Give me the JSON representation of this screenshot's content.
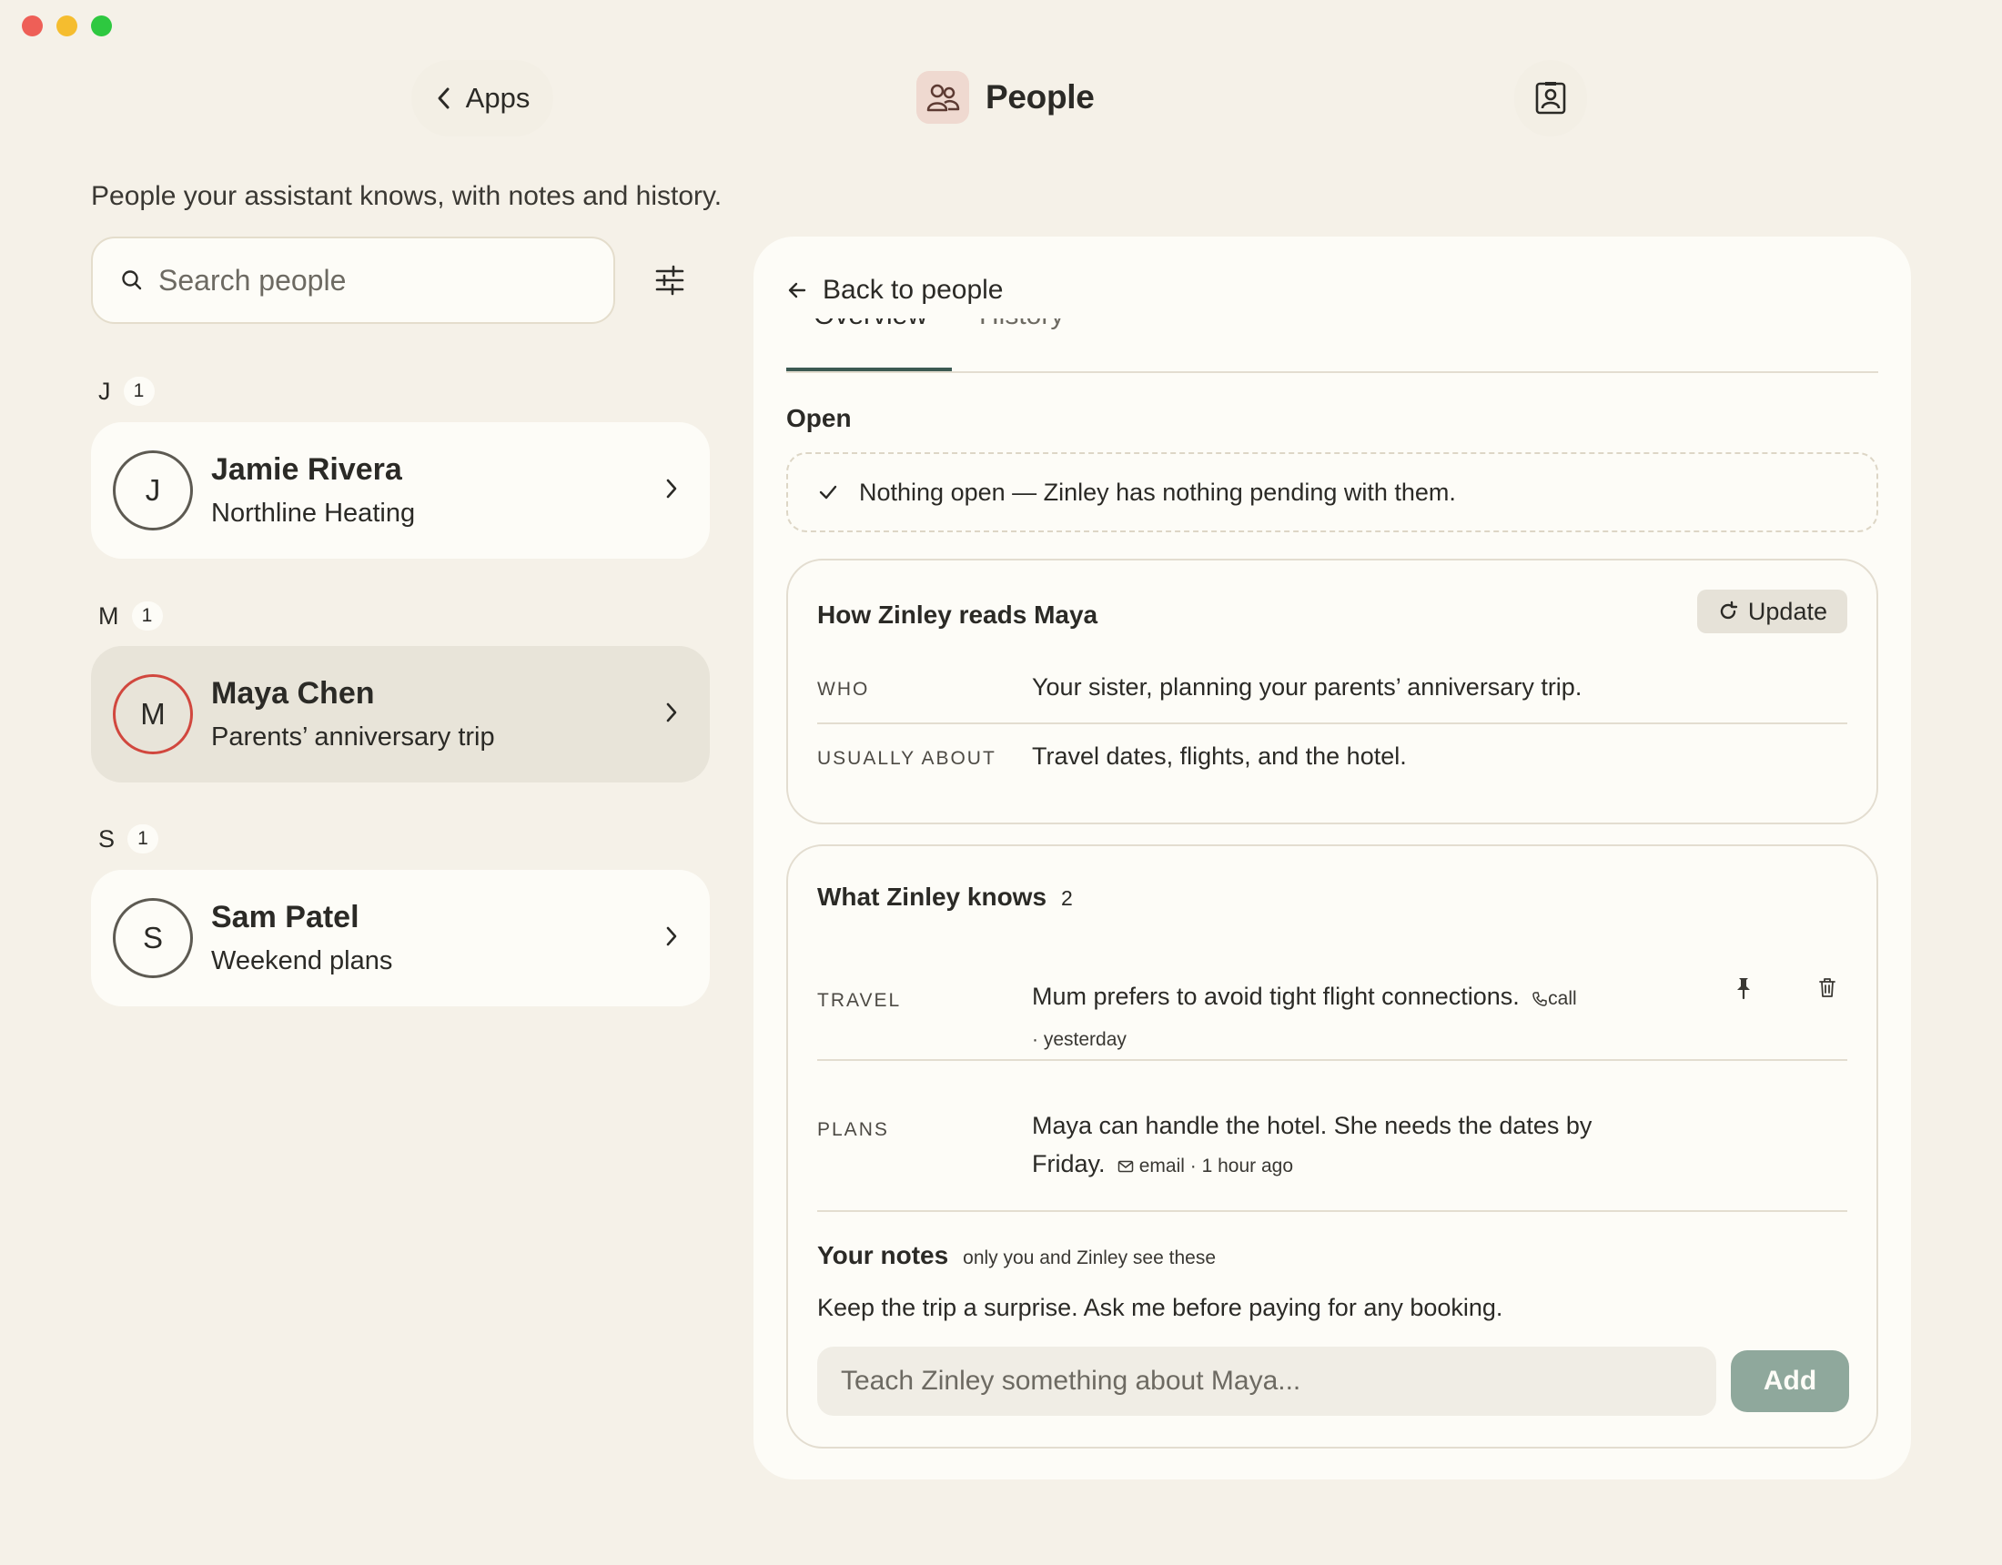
{
  "window": {
    "title": "People"
  },
  "header": {
    "back_label": "Apps",
    "title": "People",
    "back_icon": "chevron-left-icon",
    "app_icon": "people-icon",
    "contact_icon": "contact-card-icon"
  },
  "subtitle": "People your assistant knows, with notes and history.",
  "search": {
    "placeholder": "Search people",
    "value": ""
  },
  "groups": [
    {
      "letter": "J",
      "count": "1",
      "people": [
        {
          "initial": "J",
          "name": "Jamie Rivera",
          "subtitle": "Northline Heating"
        }
      ]
    },
    {
      "letter": "M",
      "count": "1",
      "people": [
        {
          "initial": "M",
          "name": "Maya Chen",
          "subtitle": "Parents’ anniversary trip",
          "selected": true
        }
      ]
    },
    {
      "letter": "S",
      "count": "1",
      "people": [
        {
          "initial": "S",
          "name": "Sam Patel",
          "subtitle": "Weekend plans"
        }
      ]
    }
  ],
  "detail": {
    "back_label": "Back to people",
    "tabs": [
      {
        "label": "Overview",
        "active": true
      },
      {
        "label": "History",
        "active": false
      }
    ],
    "open_label": "Open",
    "open_message": "Nothing open — Zinley has nothing pending with them.",
    "reads": {
      "title": "How Zinley reads Maya",
      "update_label": "Update",
      "rows": [
        {
          "label": "WHO",
          "value": "Your sister, planning your parents’ anniversary trip."
        },
        {
          "label": "USUALLY ABOUT",
          "value": "Travel dates, flights, and the hotel."
        }
      ]
    },
    "knows": {
      "title": "What Zinley knows",
      "count": "2",
      "facts": [
        {
          "label": "TRAVEL",
          "text": "Mum prefers to avoid tight flight connections.",
          "source": "call",
          "source_icon": "phone-icon",
          "time": "· yesterday"
        },
        {
          "label": "PLANS",
          "text": "Maya can handle the hotel. She needs the dates by Friday.",
          "source": "email",
          "source_icon": "mail-icon",
          "time": "· 1 hour ago"
        }
      ]
    },
    "notes": {
      "title": "Your notes",
      "hint": "only you and Zinley see these",
      "text": "Keep the trip a surprise. Ask me before paying for any booking.",
      "input_placeholder": "Teach Zinley something about Maya...",
      "add_label": "Add"
    }
  },
  "colors": {
    "accent": "#3c5a52",
    "add_button": "#8fa89c",
    "selected_avatar": "#d1473e",
    "background": "#f5f1e8"
  }
}
